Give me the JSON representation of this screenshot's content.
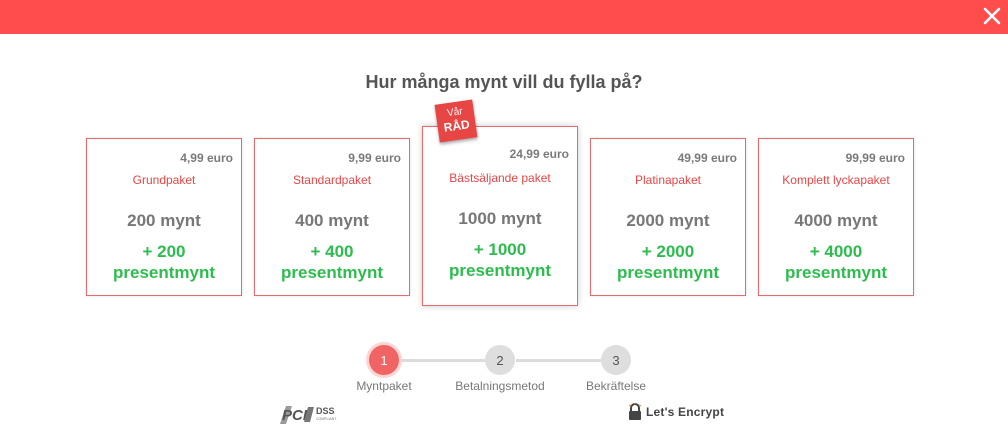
{
  "header": {
    "close_icon": "close-icon",
    "color": "#ff4d4d"
  },
  "heading": "Hur många mynt vill du fylla på?",
  "badge": {
    "line1": "Vår",
    "line2": "RÅD"
  },
  "packages": [
    {
      "price": "4,99 euro",
      "name": "Grundpaket",
      "coins": "200 mynt",
      "bonus_line1": "+ 200",
      "bonus_line2": "presentmynt"
    },
    {
      "price": "9,99 euro",
      "name": "Standardpaket",
      "coins": "400 mynt",
      "bonus_line1": "+ 400",
      "bonus_line2": "presentmynt"
    },
    {
      "price": "24,99 euro",
      "name": "Bästsäljande paket",
      "coins": "1000 mynt",
      "bonus_line1": "+ 1000",
      "bonus_line2": "presentmynt"
    },
    {
      "price": "49,99 euro",
      "name": "Platinapaket",
      "coins": "2000 mynt",
      "bonus_line1": "+ 2000",
      "bonus_line2": "presentmynt"
    },
    {
      "price": "99,99 euro",
      "name": "Komplett lyckapaket",
      "coins": "4000 mynt",
      "bonus_line1": "+ 4000",
      "bonus_line2": "presentmynt"
    }
  ],
  "steps": [
    {
      "number": "1",
      "label": "Myntpaket"
    },
    {
      "number": "2",
      "label": "Betalningsmetod"
    },
    {
      "number": "3",
      "label": "Bekräftelse"
    }
  ],
  "logos": {
    "pci": {
      "main": "PCI",
      "sub": "DSS",
      "tiny": "COMPLIANT"
    },
    "lets_encrypt": "Let's Encrypt"
  },
  "colors": {
    "accent": "#e84545",
    "bonus": "#2dbd4e",
    "active_step": "#f06464"
  }
}
